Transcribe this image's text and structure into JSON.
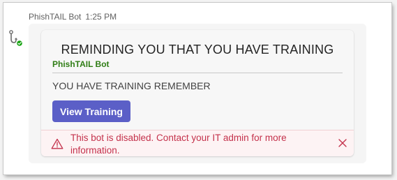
{
  "message": {
    "sender": "PhishTAIL Bot",
    "time": "1:25 PM"
  },
  "card": {
    "title": "REMINDING YOU THAT YOU HAVE TRAINING",
    "subtitle": "PhishTAIL Bot",
    "body": "YOU HAVE TRAINING REMEMBER",
    "button_label": "View Training"
  },
  "error_banner": {
    "text": "This bot is disabled. Contact your IT admin for more information.",
    "icon": "warning-triangle-icon",
    "close_icon": "close-icon"
  },
  "colors": {
    "accent": "#5b5fc7",
    "subtitle_green": "#2f7d15",
    "error_red": "#c4314b",
    "status_green": "#13a10e"
  }
}
